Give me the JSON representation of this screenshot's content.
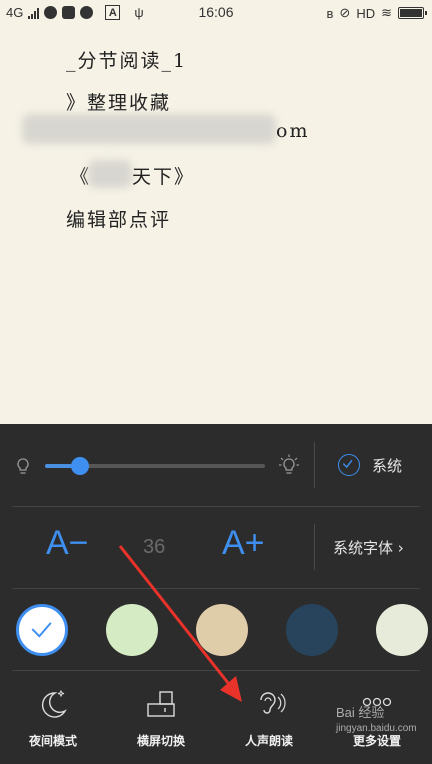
{
  "status_bar": {
    "network": "4G",
    "time": "16:06",
    "hd": "HD",
    "app_icon_letter": "A"
  },
  "reading": {
    "lines": [
      "_分节阅读_1",
      "》整理收藏",
      "《",
      "天下》",
      "编辑部点评"
    ],
    "blurred_line_tail": "om"
  },
  "brightness": {
    "level": 0.16,
    "follow_system_label": "系统",
    "follow_system_checked": true
  },
  "font": {
    "decrease_label": "A−",
    "size": "36",
    "increase_label": "A+",
    "typeface_label": "系统字体 ›"
  },
  "themes": {
    "colors": [
      "#ffffff",
      "#d4ebc3",
      "#dfcca8",
      "#27445c",
      "#e6ecd9"
    ],
    "selected_index": 0
  },
  "bottom_bar": {
    "items": [
      {
        "label": "夜间模式",
        "icon": "moon-icon"
      },
      {
        "label": "横屏切换",
        "icon": "rotate-screen-icon"
      },
      {
        "label": "人声朗读",
        "icon": "ear-icon"
      },
      {
        "label": "更多设置",
        "icon": "more-dots-icon"
      }
    ]
  },
  "colors": {
    "accent": "#3e8ff0",
    "panel_bg": "#2c2c2c",
    "page_bg": "#f6f2e6",
    "annotation_arrow": "#e8322a"
  },
  "watermark": {
    "text": "Bai 经验",
    "url": "jingyan.baidu.com"
  }
}
